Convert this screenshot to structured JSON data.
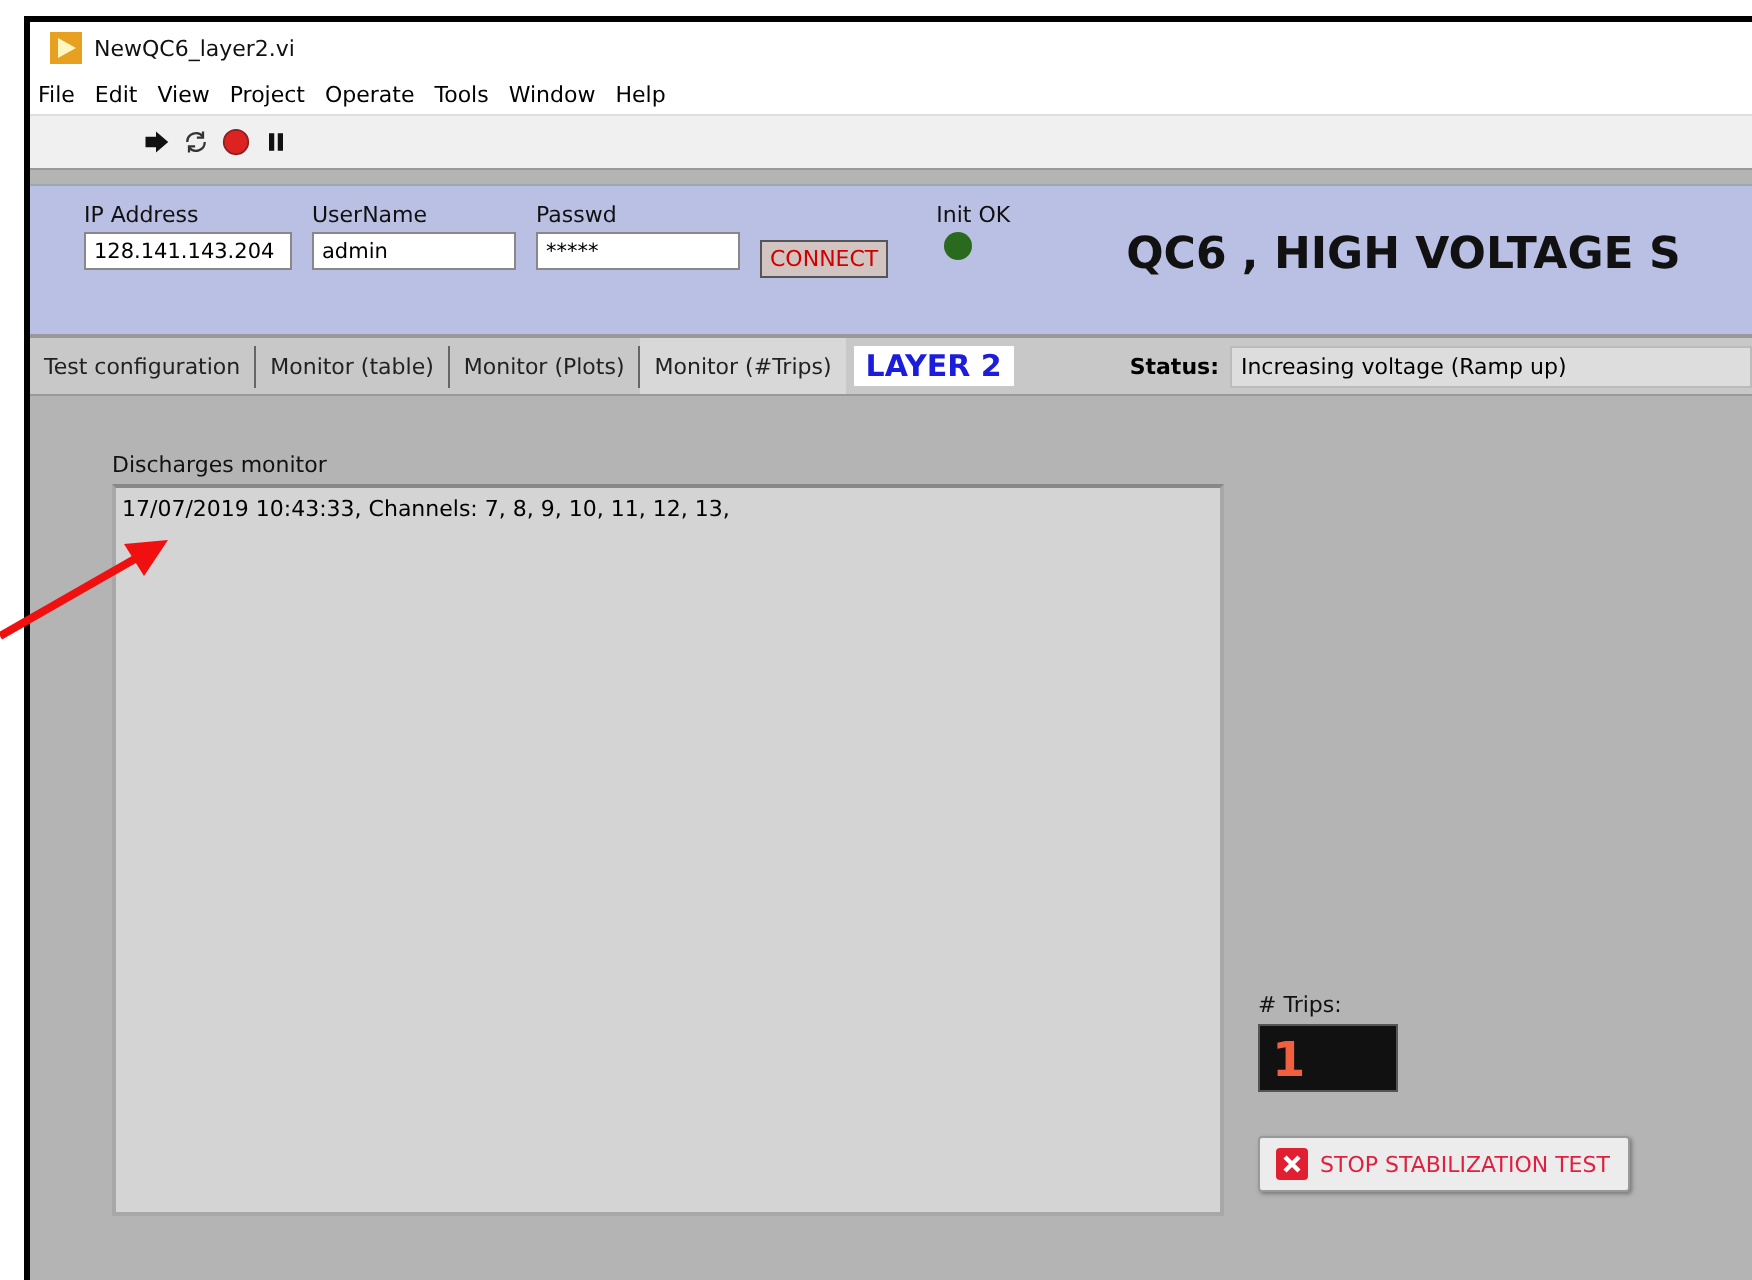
{
  "window": {
    "title": "NewQC6_layer2.vi"
  },
  "menu": [
    "File",
    "Edit",
    "View",
    "Project",
    "Operate",
    "Tools",
    "Window",
    "Help"
  ],
  "header": {
    "fields": [
      {
        "label": "IP Address",
        "value": "128.141.143.204"
      },
      {
        "label": "UserName",
        "value": "admin"
      },
      {
        "label": "Passwd",
        "value": "*****"
      }
    ],
    "connect_button": "CONNECT",
    "init_led": {
      "label": "Init OK",
      "on": true
    },
    "title": "QC6 , HIGH VOLTAGE S"
  },
  "tabs": [
    {
      "label": "Test configuration",
      "selected": false
    },
    {
      "label": "Monitor (table)",
      "selected": false
    },
    {
      "label": "Monitor (Plots)",
      "selected": false
    },
    {
      "label": "Monitor (#Trips)",
      "selected": true
    }
  ],
  "layer_label": "LAYER 2",
  "status": {
    "label": "Status:",
    "value": "Increasing voltage (Ramp up)"
  },
  "discharges": {
    "label": "Discharges monitor",
    "lines": [
      "17/07/2019 10:43:33, Channels: 7, 8, 9, 10, 11, 12, 13,"
    ]
  },
  "trips": {
    "label": "# Trips:",
    "value": "1"
  },
  "stop_button": "STOP STABILIZATION TEST"
}
